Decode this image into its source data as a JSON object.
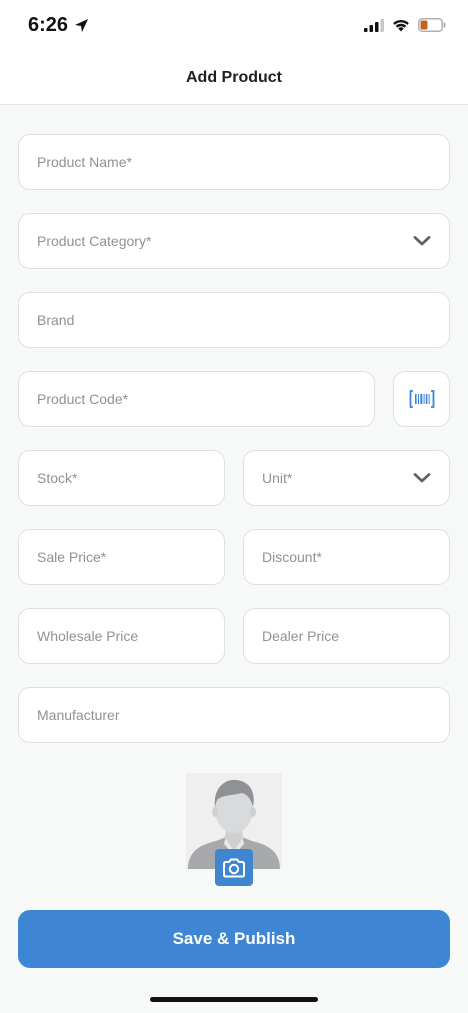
{
  "status_bar": {
    "time": "6:26"
  },
  "header": {
    "title": "Add Product"
  },
  "form": {
    "product_name": {
      "placeholder": "Product Name*"
    },
    "product_category": {
      "placeholder": "Product Category*"
    },
    "brand": {
      "placeholder": "Brand"
    },
    "product_code": {
      "placeholder": "Product Code*"
    },
    "stock": {
      "placeholder": "Stock*"
    },
    "unit": {
      "placeholder": "Unit*"
    },
    "sale_price": {
      "placeholder": "Sale Price*"
    },
    "discount": {
      "placeholder": "Discount*"
    },
    "wholesale_price": {
      "placeholder": "Wholesale Price"
    },
    "dealer_price": {
      "placeholder": "Dealer Price"
    },
    "manufacturer": {
      "placeholder": "Manufacturer"
    }
  },
  "icons": {
    "location": "location-arrow-icon",
    "signal": "cellular-signal-icon",
    "wifi": "wifi-icon",
    "battery": "battery-icon",
    "dropdown": "chevron-down-icon",
    "barcode": "barcode-scan-icon",
    "camera": "camera-icon",
    "avatar": "avatar-placeholder"
  },
  "actions": {
    "save_publish": "Save & Publish"
  },
  "colors": {
    "accent": "#3e86d3",
    "battery_level": "#c1651c",
    "field_border": "#dde1e4",
    "placeholder_text": "#8e9296"
  }
}
